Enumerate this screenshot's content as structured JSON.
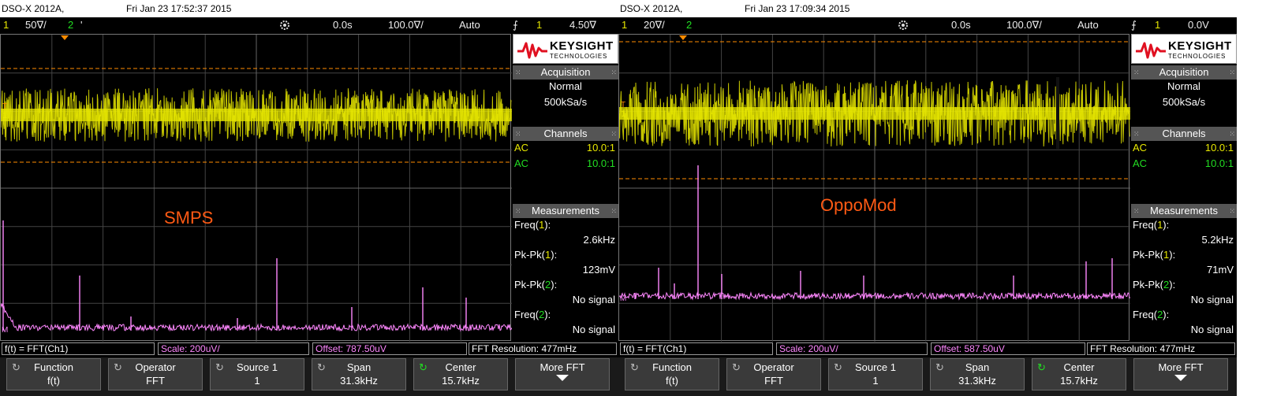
{
  "colors": {
    "channel1": "#e8e800",
    "channel2": "#22dd22",
    "math": "#ff88ff",
    "cursor": "#ff8c00",
    "annotation": "#ff5a14"
  },
  "scopes": [
    {
      "title": {
        "model": "DSO-X 2012A,",
        "date": "Fri Jan 23 17:52:37 2015"
      },
      "status": {
        "ch1": "1",
        "ch1_scale": "50∇/",
        "ch2": "2",
        "ch2_mark": "'",
        "time_pos": "0.0s",
        "time_scale": "100.0∇/",
        "mode": "Auto",
        "trig_icon": "⨍",
        "trig_ch": "1",
        "trig_level": "4.50∇"
      },
      "annotation": "SMPS",
      "brand": {
        "wordmark": "KEYSIGHT",
        "tagline": "TECHNOLOGIES"
      },
      "acquisition": {
        "header": "Acquisition",
        "mode": "Normal",
        "rate": "500kSa/s"
      },
      "channels": {
        "header": "Channels",
        "rows": [
          {
            "coupling": "AC",
            "probe": "10.0:1"
          },
          {
            "coupling": "AC",
            "probe": "10.0:1"
          }
        ]
      },
      "measurements": {
        "header": "Measurements",
        "items": [
          {
            "name": "Freq(",
            "ch": "1",
            "close": "):",
            "value": "2.6kHz"
          },
          {
            "name": "Pk-Pk(",
            "ch": "1",
            "close": "):",
            "value": "123mV"
          },
          {
            "name": "Pk-Pk(",
            "ch": "2",
            "close": "):",
            "value": "No signal"
          },
          {
            "name": "Freq(",
            "ch": "2",
            "close": "):",
            "value": "No signal"
          }
        ]
      },
      "fft_bar": {
        "function": "f(t) = FFT(Ch1)",
        "scale": "Scale: 200uV/",
        "offset": "Offset: 787.50uV",
        "resolution": "FFT Resolution: 477mHz"
      },
      "softkeys": [
        {
          "label": "Function",
          "value": "f(t)"
        },
        {
          "label": "Operator",
          "value": "FFT"
        },
        {
          "label": "Source 1",
          "value": "1"
        },
        {
          "label": "Span",
          "value": "31.3kHz"
        },
        {
          "label": "Center",
          "value": "15.7kHz"
        },
        {
          "label": "More FFT",
          "value": ""
        }
      ],
      "markers": {
        "ch1": "1",
        "trig_t": "T",
        "math": "M"
      }
    },
    {
      "title": {
        "model": "DSO-X 2012A,",
        "date": "Fri Jan 23 17:09:34 2015"
      },
      "status": {
        "ch1": "1",
        "ch1_scale": "20∇/",
        "ch2": "2",
        "ch2_mark": "",
        "time_pos": "0.0s",
        "time_scale": "100.0∇/",
        "mode": "Auto",
        "trig_icon": "⨍",
        "trig_ch": "1",
        "trig_level": "0.0V"
      },
      "annotation": "OppoMod",
      "brand": {
        "wordmark": "KEYSIGHT",
        "tagline": "TECHNOLOGIES"
      },
      "acquisition": {
        "header": "Acquisition",
        "mode": "Normal",
        "rate": "500kSa/s"
      },
      "channels": {
        "header": "Channels",
        "rows": [
          {
            "coupling": "AC",
            "probe": "10.0:1"
          },
          {
            "coupling": "AC",
            "probe": "10.0:1"
          }
        ]
      },
      "measurements": {
        "header": "Measurements",
        "items": [
          {
            "name": "Freq(",
            "ch": "1",
            "close": "):",
            "value": "5.2kHz"
          },
          {
            "name": "Pk-Pk(",
            "ch": "1",
            "close": "):",
            "value": "71mV"
          },
          {
            "name": "Pk-Pk(",
            "ch": "2",
            "close": "):",
            "value": "No signal"
          },
          {
            "name": "Freq(",
            "ch": "2",
            "close": "):",
            "value": "No signal"
          }
        ]
      },
      "fft_bar": {
        "function": "f(t) = FFT(Ch1)",
        "scale": "Scale: 200uV/",
        "offset": "Offset: 587.50uV",
        "resolution": "FFT Resolution: 477mHz"
      },
      "softkeys": [
        {
          "label": "Function",
          "value": "f(t)"
        },
        {
          "label": "Operator",
          "value": "FFT"
        },
        {
          "label": "Source 1",
          "value": "1"
        },
        {
          "label": "Span",
          "value": "31.3kHz"
        },
        {
          "label": "Center",
          "value": "15.7kHz"
        },
        {
          "label": "More FFT",
          "value": ""
        }
      ],
      "markers": {
        "ch1": "1",
        "trig_t": "T",
        "math": "M"
      }
    }
  ]
}
